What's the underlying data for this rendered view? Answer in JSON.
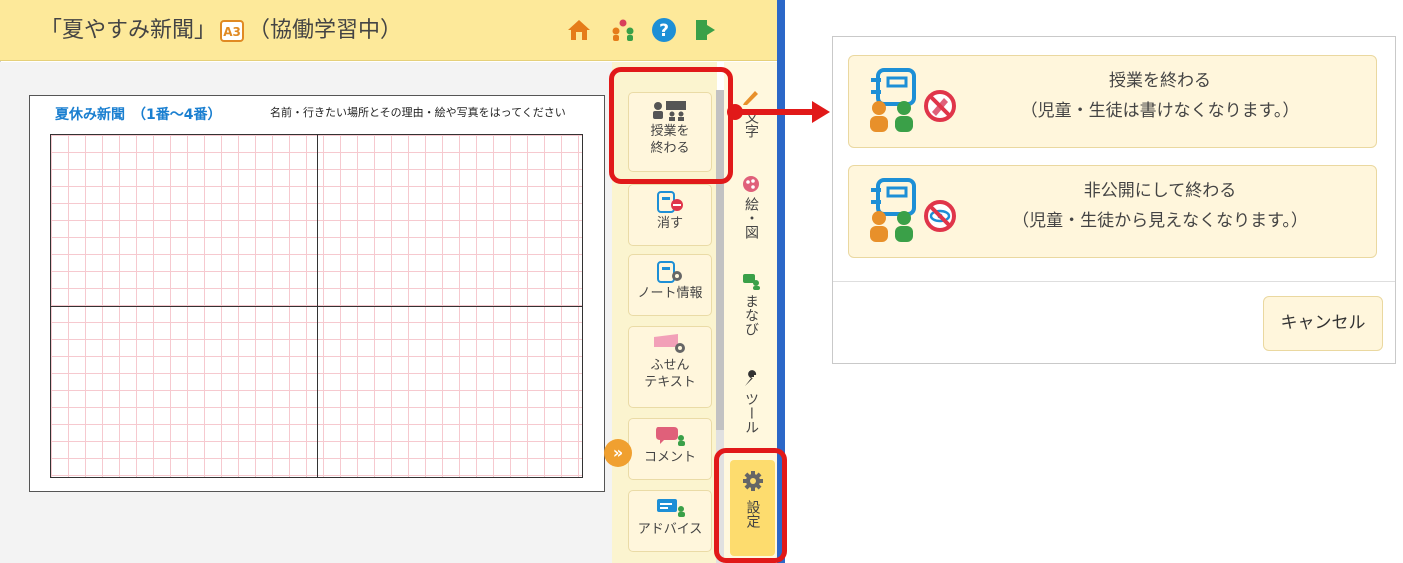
{
  "app": {
    "title_prefix": "「夏やすみ新聞」",
    "size_badge": "A3",
    "title_suffix": "（協働学習中）"
  },
  "sheet": {
    "title": "夏休み新聞　（1番～4番）",
    "instruction": "名前・行きたい場所とその理由・絵や写真をはってください"
  },
  "tools": {
    "end_class_line1": "授業を",
    "end_class_line2": "終わる",
    "erase": "消す",
    "note_info": "ノート情報",
    "sticky_line1": "ふせん",
    "sticky_line2": "テキスト",
    "comment": "コメント",
    "advice": "アドバイス"
  },
  "tabs": {
    "text": "文字",
    "draw": "絵・図",
    "learn": "まなび",
    "tools": "ツール",
    "settings": "設定"
  },
  "dialog": {
    "option1_title": "授業を終わる",
    "option1_desc": "（児童・生徒は書けなくなります。）",
    "option2_title": "非公開にして終わる",
    "option2_desc": "（児童・生徒から見えなくなります。）",
    "cancel": "キャンセル"
  },
  "colors": {
    "title_bar": "#fde99a",
    "highlight": "#e11919",
    "accent_blue": "#2b67c8",
    "button_bg": "#fff6dc"
  },
  "icons": [
    "home-icon",
    "group-icon",
    "help-icon",
    "exit-icon",
    "pencil-icon",
    "palette-icon",
    "learn-icon",
    "wrench-icon",
    "gear-icon"
  ]
}
